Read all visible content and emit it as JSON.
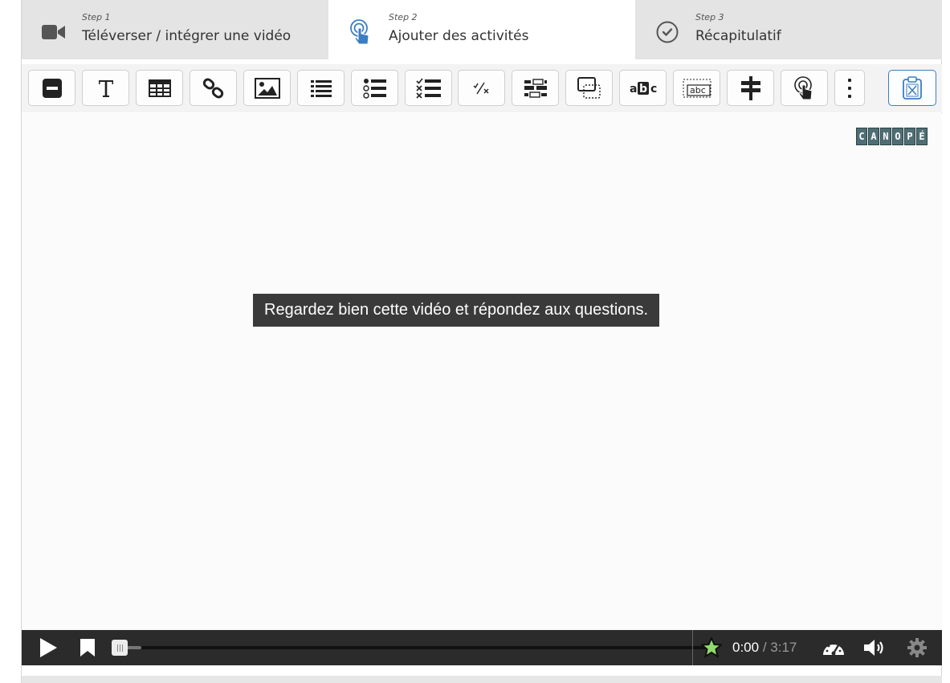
{
  "steps": [
    {
      "small": "Step 1",
      "label": "Téléverser / intégrer une vidéo",
      "icon": "video-camera-icon",
      "active": false
    },
    {
      "small": "Step 2",
      "label": "Ajouter des activités",
      "icon": "pointer-touch-icon",
      "active": true
    },
    {
      "small": "Step 3",
      "label": "Récapitulatif",
      "icon": "check-circle-icon",
      "active": false
    }
  ],
  "toolbar": {
    "tools": [
      "statement-icon",
      "text-icon",
      "table-icon",
      "link-icon",
      "image-icon",
      "list-icon",
      "single-choice-icon",
      "multiple-choice-icon",
      "true-false-icon",
      "drag-text-icon",
      "drag-drop-icon",
      "mark-words-icon",
      "fill-blanks-icon",
      "crossroads-icon",
      "navigation-hotspot-icon",
      "more-options-icon",
      "clipboard-icon"
    ]
  },
  "video": {
    "logo_letters": [
      "C",
      "A",
      "N",
      "O",
      "P",
      "É"
    ],
    "caption": "Regardez bien cette vidéo et répondez aux questions."
  },
  "player": {
    "current_time": "0:00",
    "separator": " / ",
    "duration": "3:17",
    "progress_fraction": 0.0,
    "buffered_fraction": 0.05
  },
  "colors": {
    "accent": "#3b7ec2",
    "step_inactive": "#e4e4e4",
    "controls_bg": "#2b2b2b",
    "caption_bg": "#3a3a3a",
    "star": "#8fdc6c"
  }
}
